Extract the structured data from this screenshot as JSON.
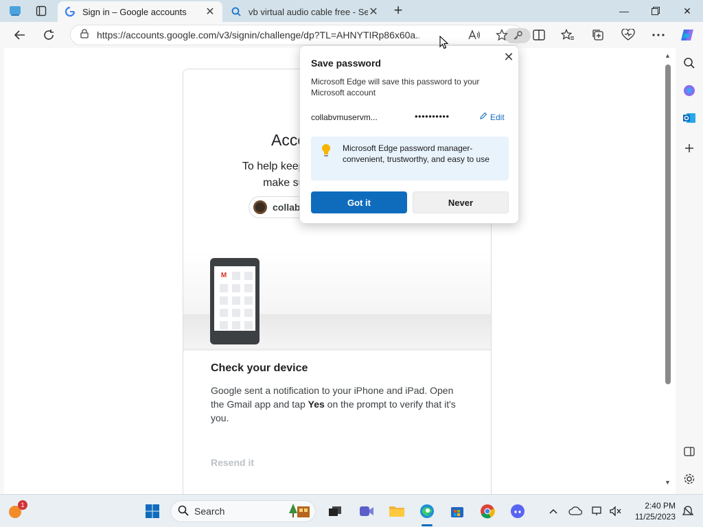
{
  "browser": {
    "tabs": [
      {
        "title": "Sign in – Google accounts",
        "active": true
      },
      {
        "title": "vb virtual audio cable free - Sear",
        "active": false
      }
    ],
    "url": "https://accounts.google.com/v3/signin/challenge/dp?TL=AHNYTIRp86x60a..."
  },
  "page": {
    "title_partial": "Acco",
    "subtitle_line1": "To help keep your",
    "subtitle_line2": "make sure that",
    "account_chip": "collabv",
    "check_title": "Check your device",
    "check_body_1": "Google sent a notification to your iPhone and iPad. Open the Gmail app and tap ",
    "check_body_bold": "Yes",
    "check_body_2": " on the prompt to verify that it's you.",
    "resend": "Resend it",
    "phone_icon_letter": "M"
  },
  "popup": {
    "title": "Save password",
    "description": "Microsoft Edge will save this password to your Microsoft account",
    "username": "collabvmuservm...",
    "password_mask": "••••••••••",
    "edit_label": "Edit",
    "tip": "Microsoft Edge password manager- convenient, trustworthy, and easy to use",
    "primary_button": "Got it",
    "secondary_button": "Never"
  },
  "taskbar": {
    "search_label": "Search",
    "time": "2:40 PM",
    "date": "11/25/2023",
    "notification_badge": "1"
  },
  "colors": {
    "accent": "#0f6cbd",
    "tip_bg": "#e8f3fc"
  }
}
